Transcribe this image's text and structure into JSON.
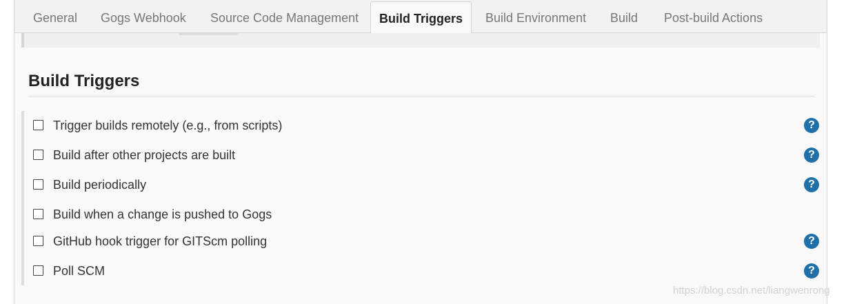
{
  "tabs": [
    {
      "label": "General",
      "active": false
    },
    {
      "label": "Gogs Webhook",
      "active": false
    },
    {
      "label": "Source Code Management",
      "active": false
    },
    {
      "label": "Build Triggers",
      "active": true
    },
    {
      "label": "Build Environment",
      "active": false
    },
    {
      "label": "Build",
      "active": false
    },
    {
      "label": "Post-build Actions",
      "active": false
    }
  ],
  "section": {
    "title": "Build Triggers"
  },
  "triggers": [
    {
      "label": "Trigger builds remotely (e.g., from scripts)",
      "checked": false,
      "has_help": true
    },
    {
      "label": "Build after other projects are built",
      "checked": false,
      "has_help": true
    },
    {
      "label": "Build periodically",
      "checked": false,
      "has_help": true
    },
    {
      "label": "Build when a change is pushed to Gogs",
      "checked": false,
      "has_help": false
    },
    {
      "label": "GitHub hook trigger for GITScm polling",
      "checked": false,
      "has_help": true
    },
    {
      "label": "Poll SCM",
      "checked": false,
      "has_help": true
    }
  ],
  "help_icon_glyph": "?",
  "watermark": "https://blog.csdn.net/liangwenrong",
  "colors": {
    "help_icon": "#1f70a8",
    "active_tab_text": "#222222",
    "inactive_tab_text": "#777777"
  }
}
